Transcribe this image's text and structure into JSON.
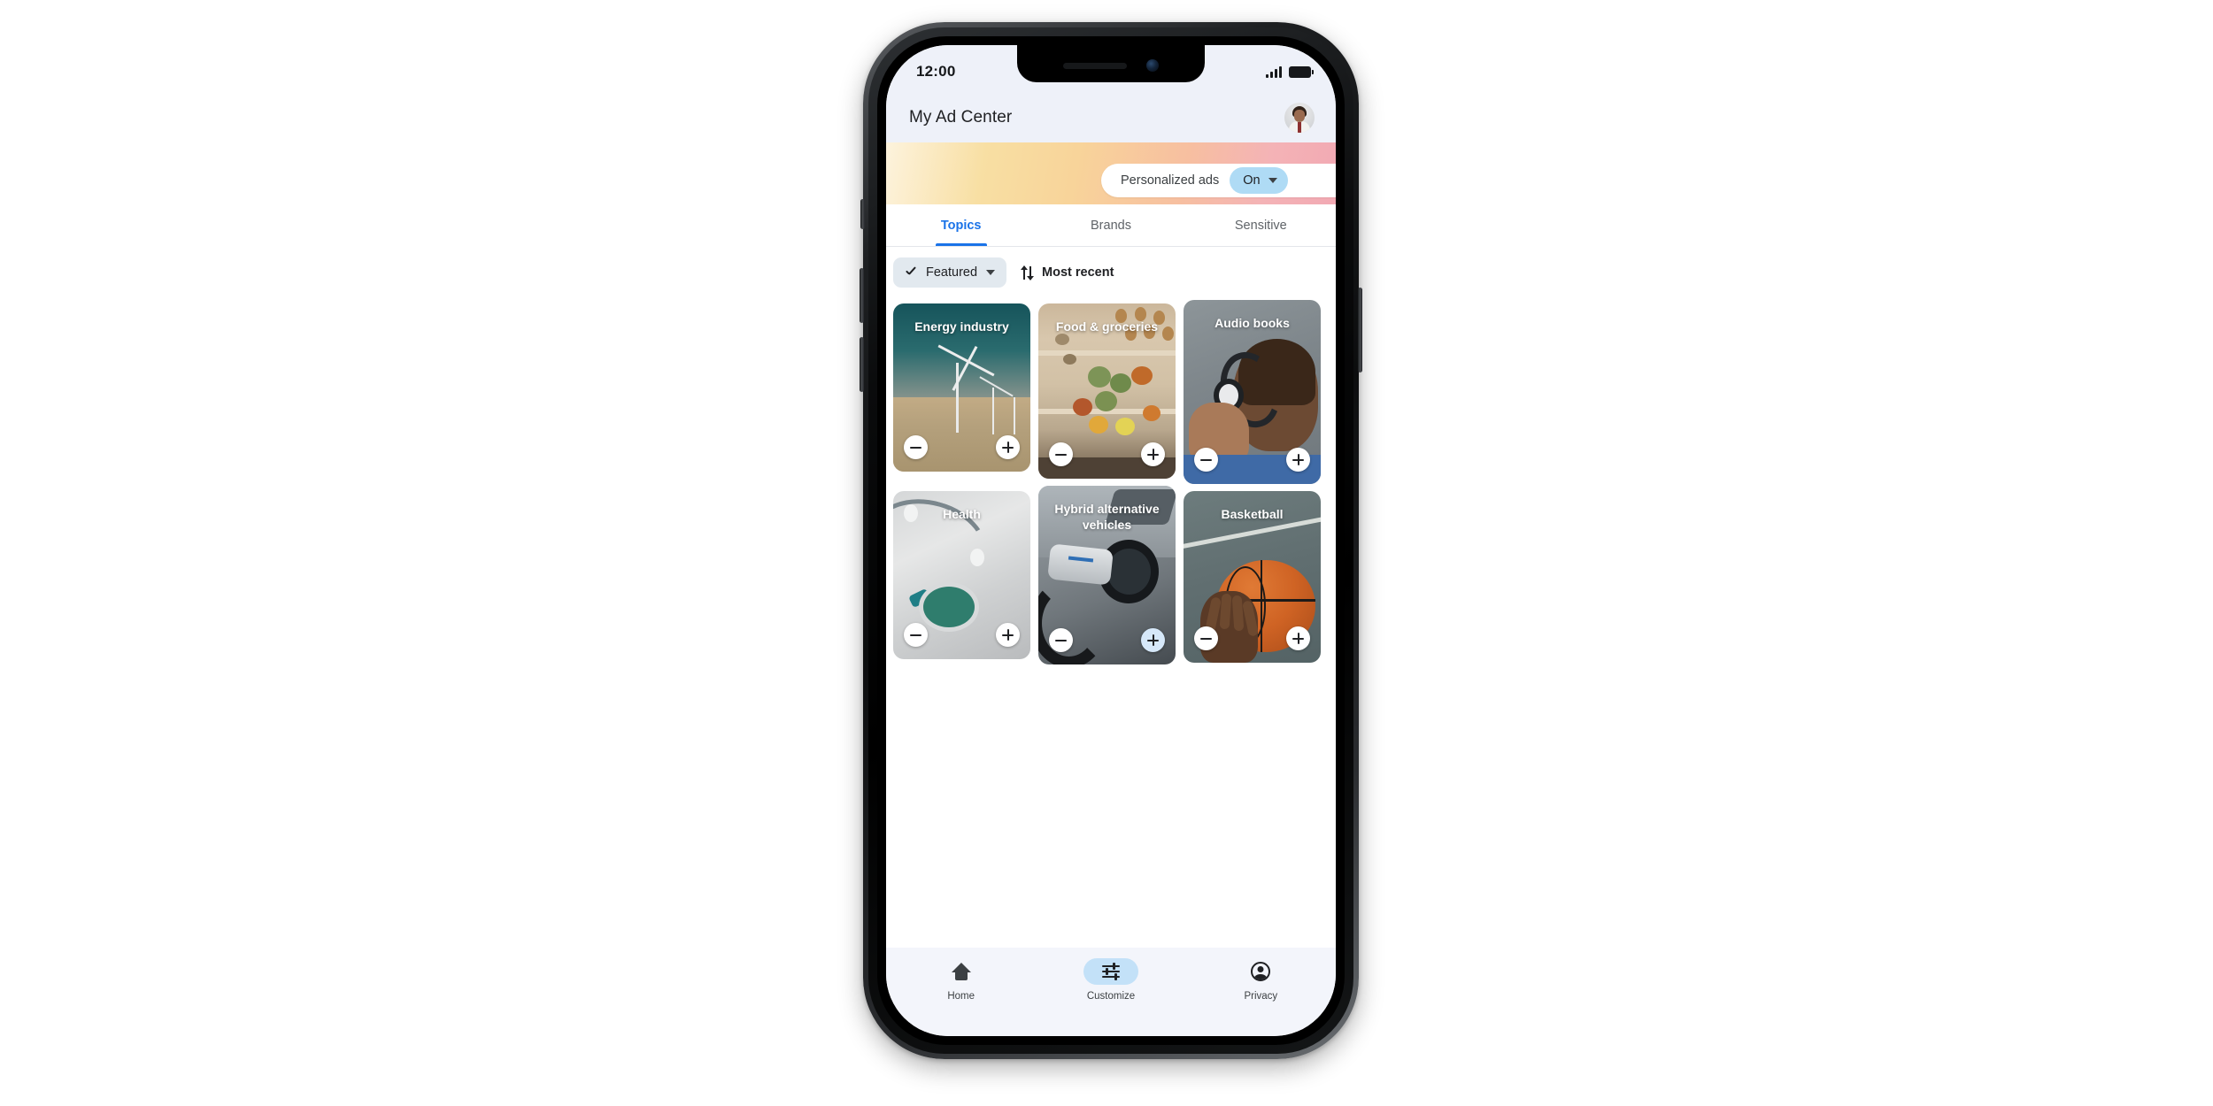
{
  "status_bar": {
    "time": "12:00",
    "signal_icon": "signal-bars-icon",
    "battery_icon": "battery-full-icon"
  },
  "app_bar": {
    "title": "My Ad Center",
    "avatar_icon": "user-avatar"
  },
  "banner": {
    "personalized_ads_label": "Personalized ads",
    "toggle_value": "On",
    "gradient_from": "#fdf3dd",
    "gradient_to": "#f2a9b3",
    "chip_color": "#AFDBF5"
  },
  "tabs": [
    {
      "label": "Topics",
      "active": true
    },
    {
      "label": "Brands",
      "active": false
    },
    {
      "label": "Sensitive",
      "active": false
    }
  ],
  "filters": {
    "featured_label": "Featured",
    "featured_icon": "check-icon",
    "featured_caret_icon": "chevron-down-icon",
    "most_recent_label": "Most recent",
    "sort_icon": "sort-arrows-icon",
    "chip_color": "#E2E9EF"
  },
  "cards": [
    {
      "title": "Energy industry",
      "scene": "wind-turbines-photo",
      "minus_label": "−",
      "plus_label": "+",
      "plus_highlighted": false
    },
    {
      "title": "Food & groceries",
      "scene": "grocery-shelf-photo",
      "minus_label": "−",
      "plus_label": "+",
      "plus_highlighted": false
    },
    {
      "title": "Audio books",
      "scene": "headphones-photo",
      "minus_label": "−",
      "plus_label": "+",
      "plus_highlighted": false
    },
    {
      "title": "Health",
      "scene": "stethoscope-photo",
      "minus_label": "−",
      "plus_label": "+",
      "plus_highlighted": false
    },
    {
      "title": "Hybrid alternative vehicles",
      "scene": "ev-charging-photo",
      "minus_label": "−",
      "plus_label": "+",
      "plus_highlighted": true
    },
    {
      "title": "Basketball",
      "scene": "basketball-photo",
      "minus_label": "−",
      "plus_label": "+",
      "plus_highlighted": false
    }
  ],
  "bottom_nav": [
    {
      "label": "Home",
      "icon": "home-icon",
      "active": false
    },
    {
      "label": "Customize",
      "icon": "tune-icon",
      "active": true
    },
    {
      "label": "Privacy",
      "icon": "account-icon",
      "active": false
    }
  ],
  "theme": {
    "accent": "#1a73e8",
    "nav_active_pill": "#C3E1F8",
    "app_bar_bg": "#EEF1F9",
    "bottom_nav_bg": "#F3F5FB"
  }
}
